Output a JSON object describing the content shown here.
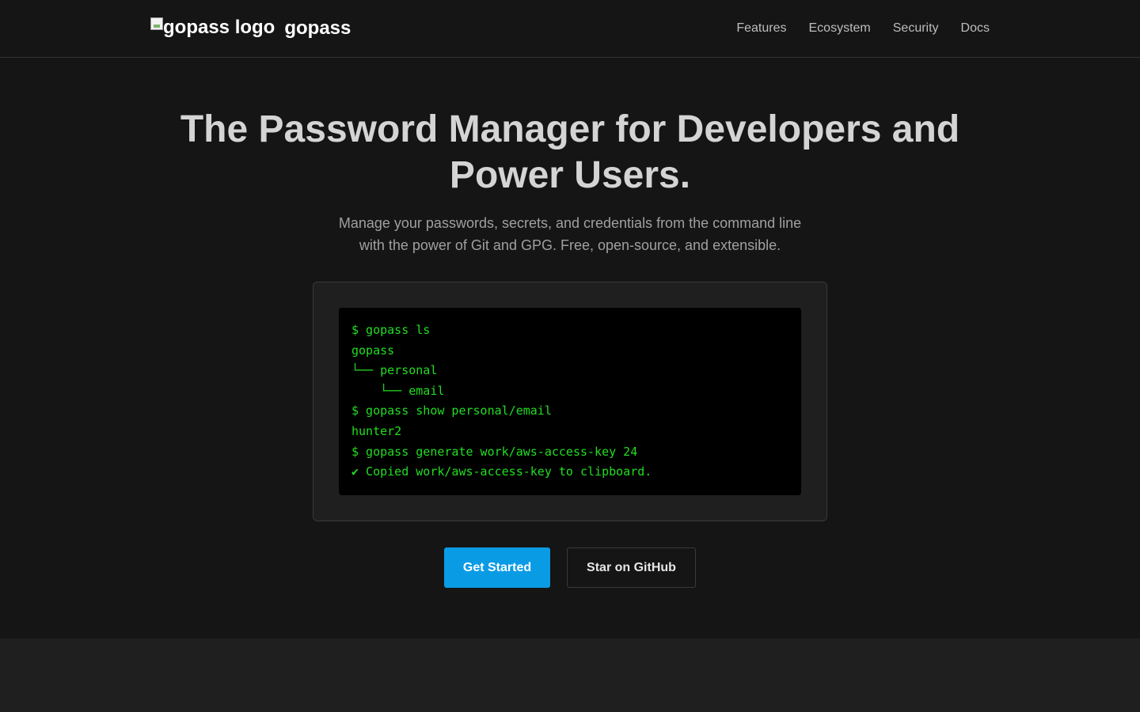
{
  "nav": {
    "logo_alt": "gopass logo",
    "brand": "gopass",
    "links": [
      {
        "label": "Features"
      },
      {
        "label": "Ecosystem"
      },
      {
        "label": "Security"
      },
      {
        "label": "Docs"
      }
    ]
  },
  "hero": {
    "title": "The Password Manager for Developers and Power Users.",
    "subtitle": "Manage your passwords, secrets, and credentials from the command line with the power of Git and GPG. Free, open-source, and extensible.",
    "terminal": {
      "lines": [
        "$ gopass ls",
        "gopass",
        "└── personal",
        "    └── email",
        "$ gopass show personal/email",
        "hunter2",
        "$ gopass generate work/aws-access-key 24",
        "✔ Copied work/aws-access-key to clipboard."
      ]
    },
    "buttons": {
      "primary": "Get Started",
      "secondary": "Star on GitHub"
    }
  },
  "colors": {
    "page_bg": "#151515",
    "terminal_text": "#22dd22",
    "primary_button": "#0a9be5"
  },
  "icons": {
    "logo": "broken-image-icon"
  }
}
